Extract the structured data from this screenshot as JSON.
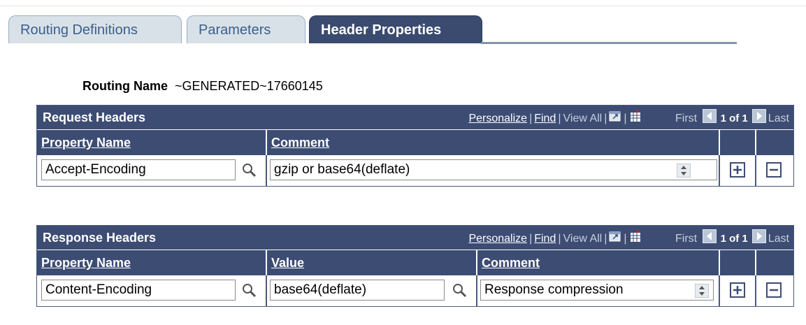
{
  "tabs": [
    {
      "label": "Routing Definitions",
      "active": false
    },
    {
      "label": "Parameters",
      "active": false
    },
    {
      "label": "Header Properties",
      "active": true
    }
  ],
  "routing": {
    "label": "Routing Name",
    "value": "~GENERATED~17660145"
  },
  "nav": {
    "personalize": "Personalize",
    "find": "Find",
    "view_all": "View All",
    "first": "First",
    "page": "1 of 1",
    "last": "Last",
    "sep": "|"
  },
  "request": {
    "title": "Request Headers",
    "headers": {
      "property": "Property Name",
      "comment": "Comment"
    },
    "row": {
      "property": "Accept-Encoding",
      "comment": "gzip or base64(deflate)"
    }
  },
  "response": {
    "title": "Response Headers",
    "headers": {
      "property": "Property Name",
      "value": "Value",
      "comment": "Comment"
    },
    "row": {
      "property": "Content-Encoding",
      "value": "base64(deflate)",
      "comment": "Response compression"
    }
  },
  "colors": {
    "header_bg": "#3c4c73",
    "tab_active": "#3b4b70",
    "tab_inactive": "#d9e1e8",
    "link": "#3b5f8a"
  },
  "icons": [
    "lookup-icon",
    "spin-icon",
    "add-row-icon",
    "delete-row-icon",
    "zoom-grid-icon",
    "download-icon",
    "previous-icon",
    "next-icon"
  ]
}
